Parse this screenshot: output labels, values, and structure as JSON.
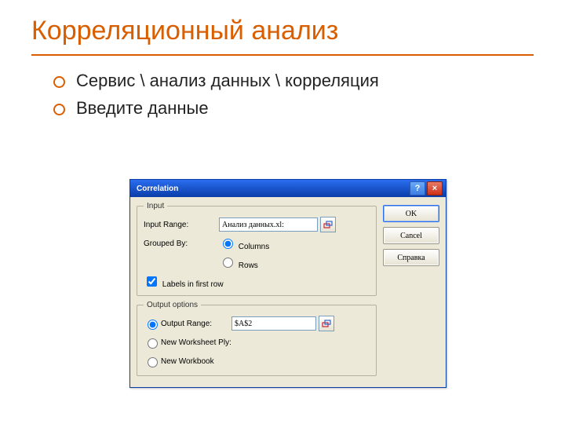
{
  "slide": {
    "title": "Корреляционный анализ",
    "bullets": [
      "Сервис \\ анализ данных \\ корреляция",
      "Введите данные"
    ]
  },
  "dialog": {
    "title": "Correlation",
    "help_caption": "?",
    "close_caption": "×",
    "input_group": "Input",
    "input_range_label": "Input Range:",
    "input_range_value": "Анализ данных.xl:",
    "grouped_by_label": "Grouped By:",
    "option_columns": "Columns",
    "option_rows": "Rows",
    "labels_first_row": "Labels in first row",
    "output_group": "Output options",
    "output_range_label": "Output Range:",
    "output_range_value": "$A$2",
    "new_ws_label": "New Worksheet Ply:",
    "new_wb_label": "New Workbook",
    "buttons": {
      "ok": "OK",
      "cancel": "Cancel",
      "help": "Справка"
    }
  }
}
